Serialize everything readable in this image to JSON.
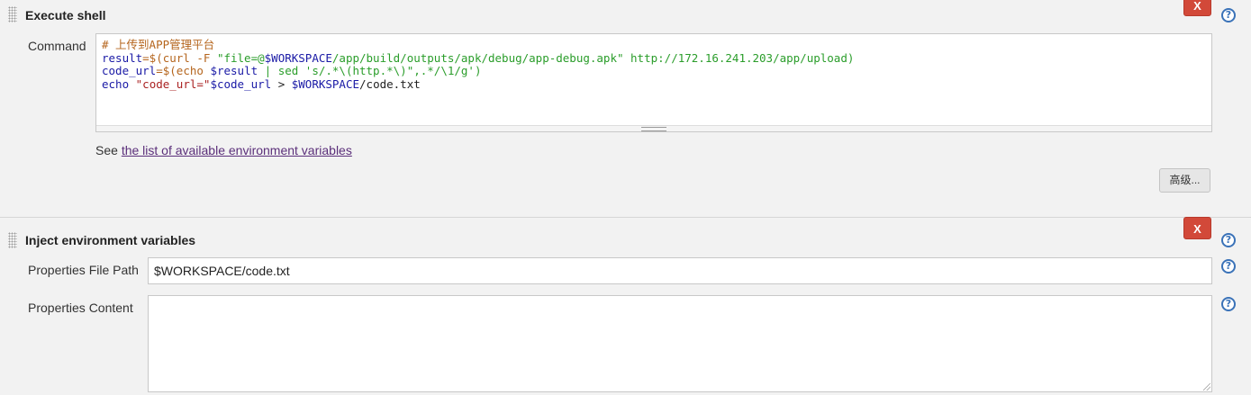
{
  "execute_shell": {
    "title": "Execute shell",
    "delete_label": "X",
    "help_label": "?",
    "command_label": "Command",
    "code": {
      "l1_comment": "# 上传到APP管理平台",
      "l2_a": "result",
      "l2_b": "=$(curl -F ",
      "l2_c": "\"file=@",
      "l2_d": "$WORKSPACE",
      "l2_e": "/app/build/outputs/apk/debug/app-debug.apk\" http://172.16.241.203/app/upload)",
      "l3_a": "code_url",
      "l3_b": "=$(echo ",
      "l3_c": "$result",
      "l3_d": " | sed 's/.*\\(http.*\\)\",.*/\\1/g')",
      "l4_a": "echo ",
      "l4_b": "\"code_url=\"",
      "l4_c": "$code_url",
      "l4_d": " > ",
      "l4_e": "$WORKSPACE",
      "l4_f": "/code.txt"
    },
    "see_prefix": "See ",
    "see_link": "the list of available environment variables",
    "advanced_label": "高级..."
  },
  "inject_env": {
    "title": "Inject environment variables",
    "delete_label": "X",
    "help_label": "?",
    "properties_file_path_label": "Properties File Path",
    "properties_file_path_value": "$WORKSPACE/code.txt",
    "properties_content_label": "Properties Content",
    "properties_content_value": ""
  },
  "colors": {
    "delete_button": "#d24939",
    "help_icon": "#3a72b8",
    "link": "#5b2f7a"
  }
}
